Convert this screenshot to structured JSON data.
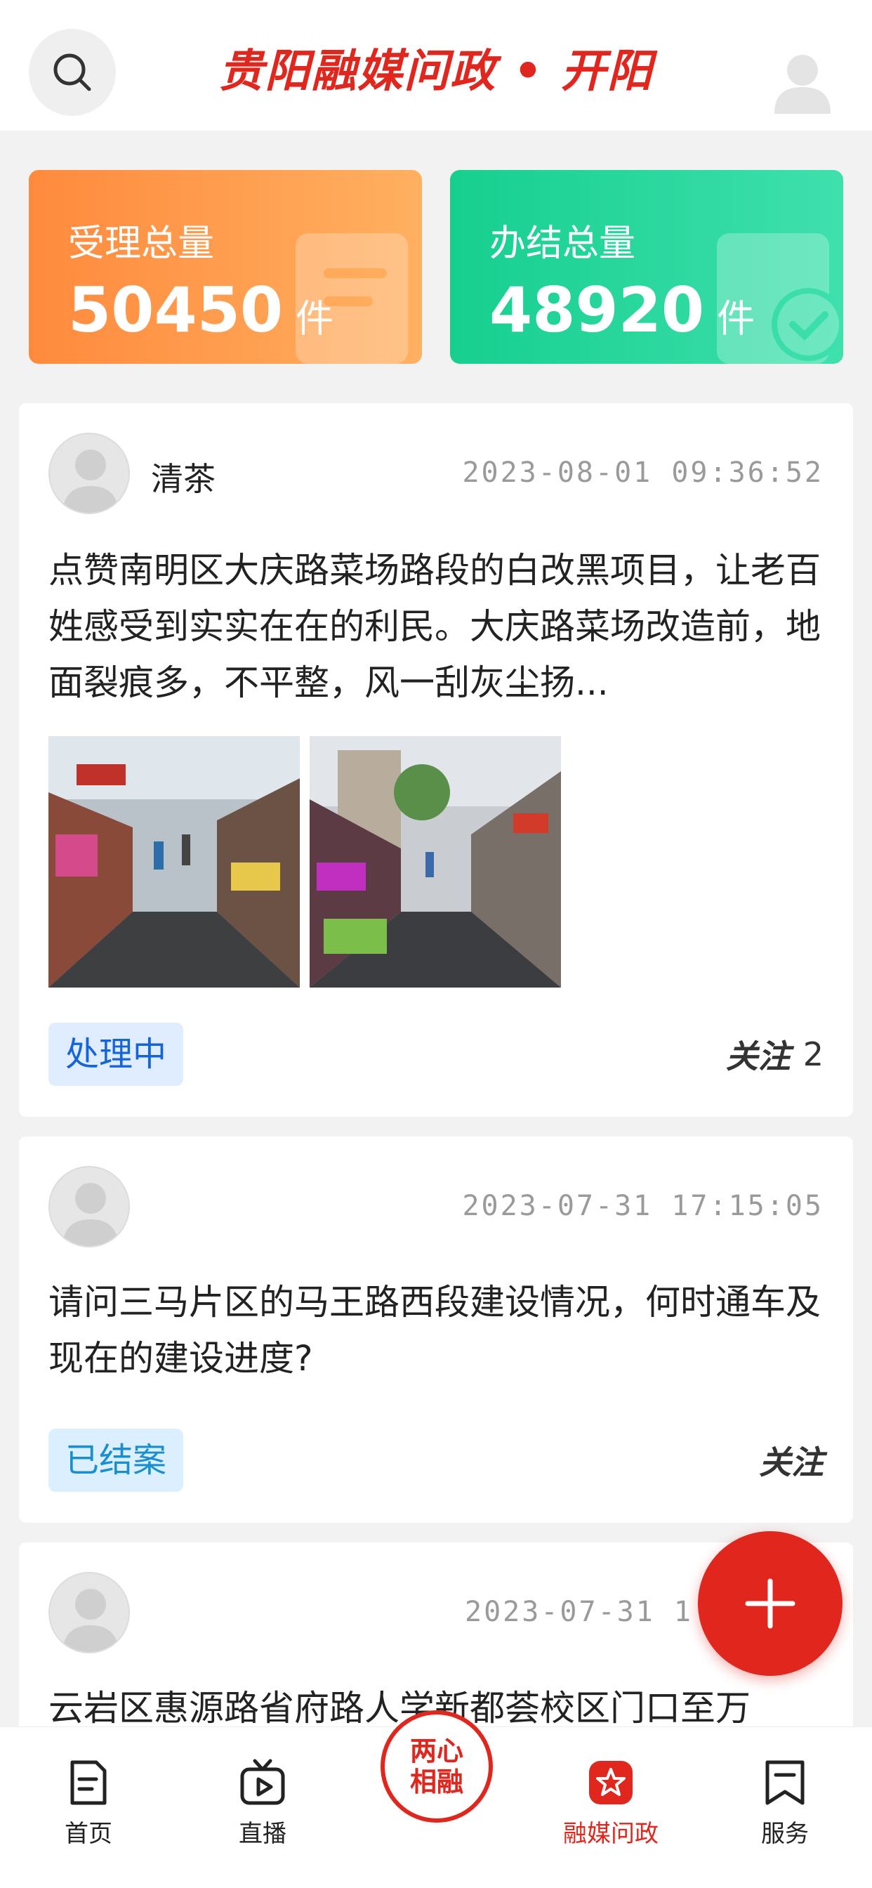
{
  "header": {
    "title": "贵阳融媒问政 • 开阳",
    "search_icon": "search-icon",
    "user_icon": "user-avatar-icon"
  },
  "stats": [
    {
      "label": "受理总量",
      "value": "50450",
      "unit": "件",
      "color": "#ff8a3d"
    },
    {
      "label": "办结总量",
      "value": "48920",
      "unit": "件",
      "color": "#16cf8f"
    }
  ],
  "posts": [
    {
      "author": "清茶",
      "time": "2023-08-01 09:36:52",
      "text": "点赞南明区大庆路菜场路段的白改黑项目，让老百姓感受到实实在在的利民。大庆路菜场改造前，地面裂痕多，不平整，风一刮灰尘扬...",
      "status": "处理中",
      "follow_label": "关注",
      "follow_count": "2"
    },
    {
      "author": "",
      "time": "2023-07-31 17:15:05",
      "text": "请问三马片区的马王路西段建设情况，何时通车及现在的建设进度?",
      "status": "已结案",
      "follow_label": "关注"
    },
    {
      "author": "",
      "time": "2023-07-31 1",
      "text": "云岩区惠源路省府路人学新都荟校区门口至万"
    }
  ],
  "fab": {
    "icon": "plus-icon"
  },
  "nav": {
    "items": [
      {
        "label": "首页",
        "icon": "home-doc-icon"
      },
      {
        "label": "直播",
        "icon": "live-tv-icon"
      },
      {
        "label": "两心相融",
        "line1": "两心",
        "line2": "相融",
        "icon": "center-logo"
      },
      {
        "label": "融媒问政",
        "icon": "star-badge-icon"
      },
      {
        "label": "服务",
        "icon": "bookmark-icon"
      }
    ],
    "active_color": "#e0261d"
  }
}
